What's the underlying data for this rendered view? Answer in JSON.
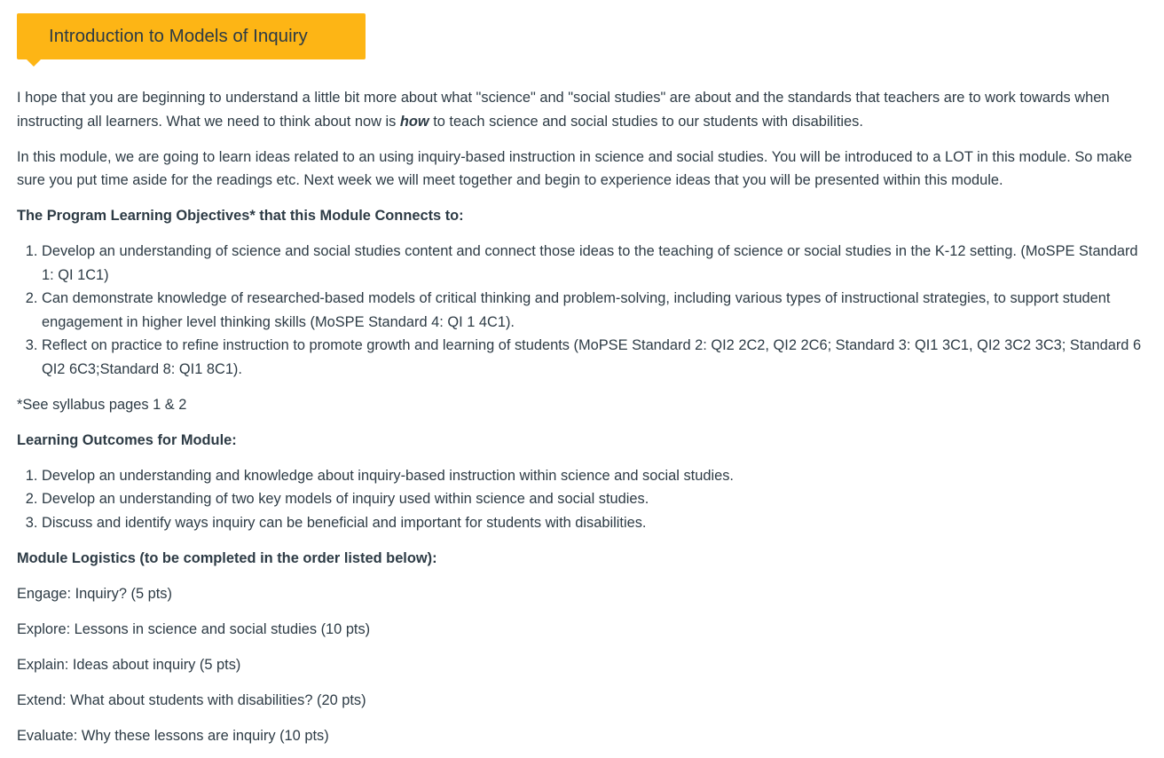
{
  "banner": {
    "title": "Introduction to Models of Inquiry",
    "color": "#fdb515"
  },
  "intro": {
    "p1_before": "I hope that you are beginning to understand a little bit more about what \"science\" and \"social studies\" are about and the standards that teachers are to work towards when instructing all learners. What we need to think about now is ",
    "p1_emph": "how",
    "p1_after": " to teach science and social studies to our students with disabilities.",
    "p2": "In this module, we are going to  learn ideas related to  an using inquiry-based instruction in science and social studies. You will be introduced to a LOT in this module. So make sure you put time aside for the readings etc. Next week we will meet together and begin to experience ideas that you will be presented within this module."
  },
  "objectives": {
    "heading": "The Program Learning Objectives* that this Module Connects to:",
    "items": [
      "Develop an understanding of science and social studies content and connect those ideas to the teaching of science or social studies in the K-12 setting. (MoSPE Standard 1: QI 1C1)",
      "Can demonstrate knowledge of researched-based models of critical thinking and problem-solving, including various types of instructional strategies, to support student engagement in higher level thinking skills (MoSPE Standard 4: QI 1 4C1).",
      "Reflect on practice to refine instruction to promote growth and learning of students (MoPSE Standard 2: QI2 2C2, QI2 2C6; Standard 3: QI1 3C1, QI2 3C2 3C3; Standard 6 QI2 6C3;Standard 8: QI1 8C1)."
    ],
    "footnote": "*See syllabus pages 1 & 2"
  },
  "outcomes": {
    "heading": "Learning Outcomes for Module:",
    "items": [
      "Develop an understanding and knowledge about inquiry-based instruction within science and social studies.",
      "Develop an understanding of two key models of inquiry used within science and social studies.",
      "Discuss and identify ways inquiry can be beneficial and important for students with disabilities."
    ]
  },
  "logistics": {
    "heading": "Module Logistics (to be completed in the order listed below):",
    "items": [
      "Engage: Inquiry? (5 pts)",
      "Explore: Lessons in science and social studies (10 pts)",
      "Explain: Ideas about inquiry (5 pts)",
      "Extend: What about students with disabilities? (20 pts)",
      "Evaluate: Why these lessons are inquiry (10 pts)"
    ]
  }
}
